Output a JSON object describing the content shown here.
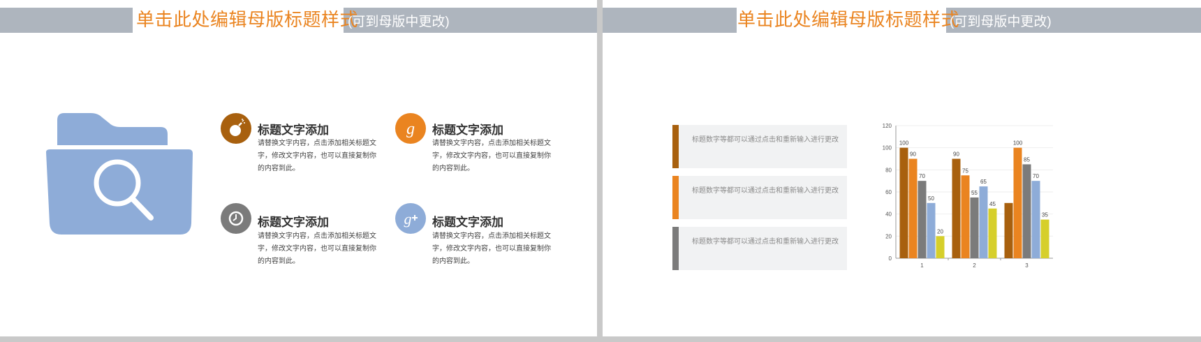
{
  "slide_left": {
    "header": {
      "title": "单击此处编辑母版标题样式",
      "subtitle": "(可到母版中更改)"
    },
    "features": [
      {
        "icon": "bomb-icon",
        "color": "#a8600e",
        "title": "标题文字添加",
        "desc": "请替换文字内容，点击添加相关标题文字，修改文字内容，也可以直接复制你的内容到此。"
      },
      {
        "icon": "google-g-icon",
        "color": "#ea8420",
        "title": "标题文字添加",
        "desc": "请替换文字内容，点击添加相关标题文字，修改文字内容，也可以直接复制你的内容到此。"
      },
      {
        "icon": "clock-icon",
        "color": "#7b7b7b",
        "title": "标题文字添加",
        "desc": "请替换文字内容，点击添加相关标题文字，修改文字内容，也可以直接复制你的内容到此。"
      },
      {
        "icon": "google-plus-icon",
        "color": "#8eacd8",
        "title": "标题文字添加",
        "desc": "请替换文字内容，点击添加相关标题文字，修改文字内容，也可以直接复制你的内容到此。"
      }
    ],
    "folder_color": "#8eacd8"
  },
  "slide_right": {
    "header": {
      "title": "单击此处编辑母版标题样式",
      "subtitle": "(可到母版中更改)"
    },
    "cards": [
      {
        "color": "#a8600e",
        "text": "标题数字等都可以通过点击和重新输入进行更改"
      },
      {
        "color": "#ea8420",
        "text": "标题数字等都可以通过点击和重新输入进行更改"
      },
      {
        "color": "#7b7b7b",
        "text": "标题数字等都可以通过点击和重新输入进行更改"
      }
    ]
  },
  "chart_data": {
    "type": "bar",
    "title": "",
    "xlabel": "",
    "ylabel": "",
    "categories": [
      "1",
      "2",
      "3"
    ],
    "ylim": [
      0,
      120
    ],
    "yticks": [
      0,
      20,
      40,
      60,
      80,
      100,
      120
    ],
    "grid": true,
    "series": [
      {
        "color": "#a8600e",
        "values": [
          100,
          90,
          50
        ],
        "labels": [
          "100",
          "90",
          ""
        ]
      },
      {
        "color": "#ea8420",
        "values": [
          90,
          75,
          100
        ],
        "labels": [
          "90",
          "75",
          "100"
        ]
      },
      {
        "color": "#7b7b7b",
        "values": [
          70,
          55,
          85
        ],
        "labels": [
          "70",
          "55",
          "85"
        ]
      },
      {
        "color": "#8eacd8",
        "values": [
          50,
          65,
          70
        ],
        "labels": [
          "50",
          "65",
          "70"
        ]
      },
      {
        "color": "#d6cf2b",
        "values": [
          20,
          45,
          35
        ],
        "labels": [
          "20",
          "45",
          "35"
        ]
      }
    ]
  }
}
